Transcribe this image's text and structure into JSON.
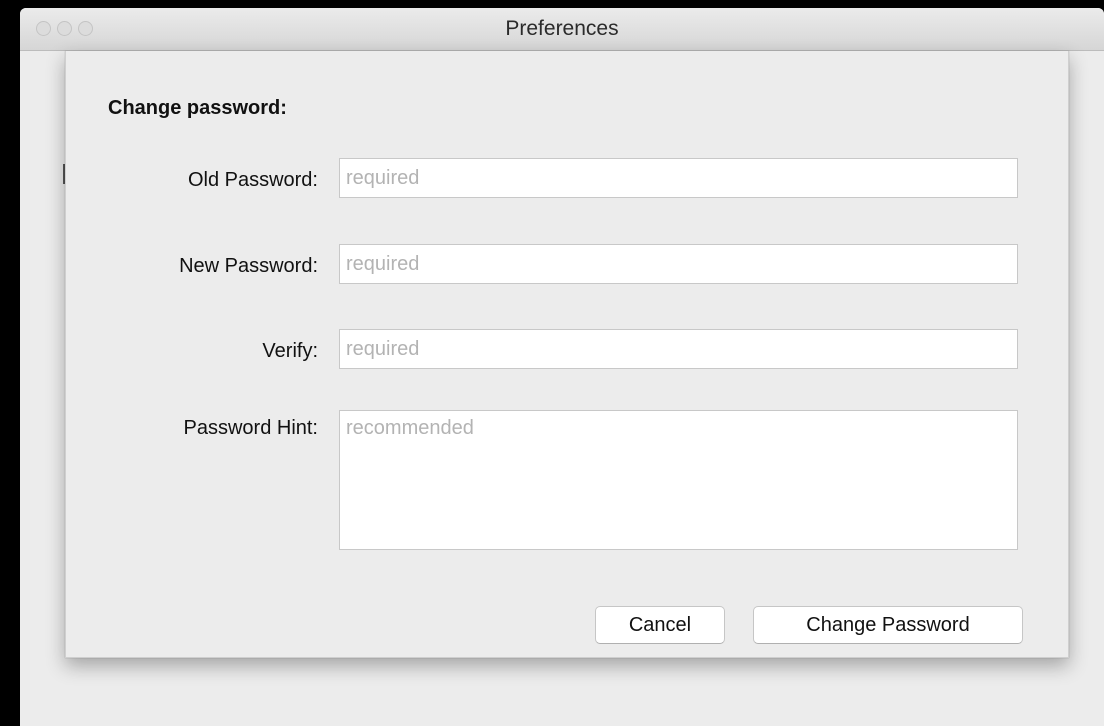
{
  "window": {
    "title": "Preferences"
  },
  "sheet": {
    "heading": "Change password:",
    "fields": {
      "old_password": {
        "label": "Old Password:",
        "placeholder": "required",
        "value": ""
      },
      "new_password": {
        "label": "New Password:",
        "placeholder": "required",
        "value": ""
      },
      "verify": {
        "label": "Verify:",
        "placeholder": "required",
        "value": ""
      },
      "hint": {
        "label": "Password Hint:",
        "placeholder": "recommended",
        "value": ""
      }
    },
    "buttons": {
      "cancel": "Cancel",
      "change_password": "Change Password"
    }
  },
  "icons": {
    "close": "traffic-light-close-icon",
    "minimize": "traffic-light-minimize-icon",
    "zoom": "traffic-light-zoom-icon"
  },
  "colors": {
    "window_background": "#ececec",
    "placeholder_text": "#b3b3b3",
    "screen_background": "#000000"
  }
}
